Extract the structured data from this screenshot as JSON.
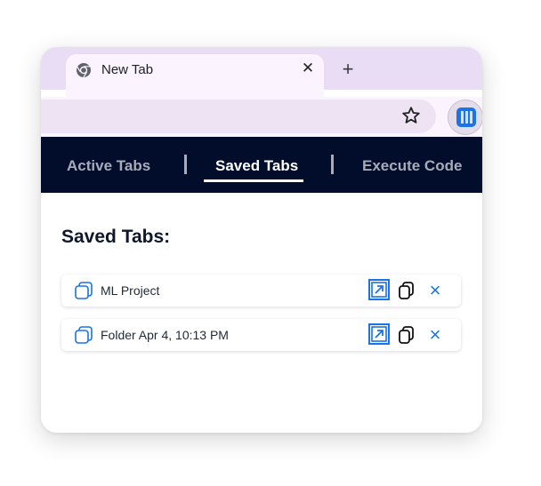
{
  "browser": {
    "tab": {
      "title": "New Tab",
      "favicon": "chrome-icon",
      "close_glyph": "✕"
    },
    "new_tab_glyph": "+",
    "toolbar": {
      "bookmark_icon": "star-icon",
      "extension_icon": "extension-bars-icon"
    }
  },
  "nav": {
    "items": [
      {
        "label": "Active Tabs",
        "active": false
      },
      {
        "label": "Saved Tabs",
        "active": true
      },
      {
        "label": "Execute Code",
        "active": false
      }
    ]
  },
  "main": {
    "heading": "Saved Tabs:",
    "saved_items": [
      {
        "label": "ML Project",
        "icon": "folder-tabs-icon"
      },
      {
        "label": "Folder Apr 4, 10:13 PM",
        "icon": "folder-tabs-icon"
      }
    ],
    "delete_glyph": "×"
  },
  "colors": {
    "accent": "#1a73e8",
    "nav_background": "#020d2b",
    "tabstrip": "#e9dcf5"
  }
}
